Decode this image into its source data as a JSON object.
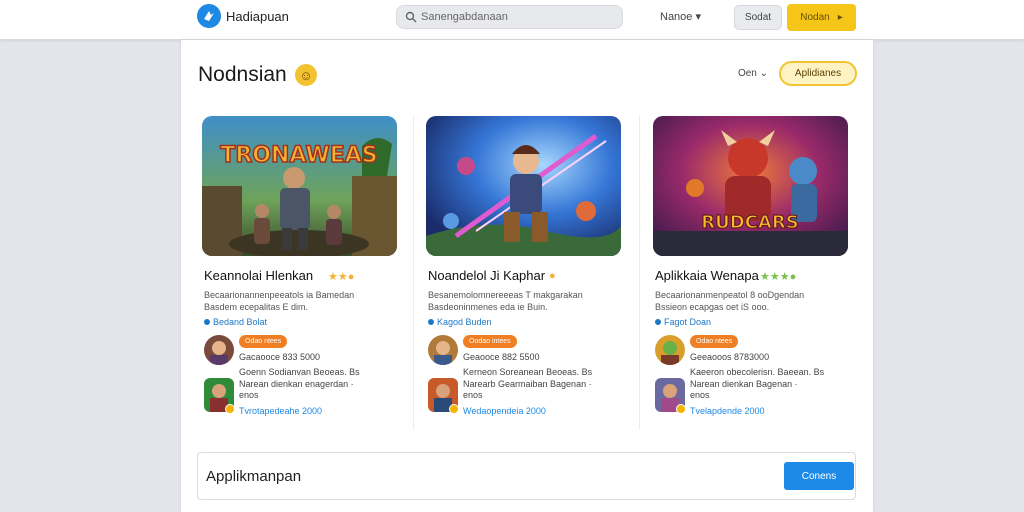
{
  "header": {
    "app_name": "Hadiapuan",
    "search_placeholder": "Sanengabdanaan",
    "nav_menu": "Nanoe",
    "nav_menu_caret": "▾",
    "secondary_button": "Sodat",
    "primary_button": "Nodan"
  },
  "section": {
    "title": "Nodnsian",
    "title_emoji": "☺",
    "filter_label": "Oen",
    "filter_caret": "⌄",
    "filter_button": "Aplidianes"
  },
  "cards": [
    {
      "banner_text": "TRONAWEAS",
      "title": "Keannolai Hlenkan",
      "stars": "★★●",
      "description": "Becaarionannenpeeatols ia Bamedan\nBasdem ecepalitas E dim.",
      "tag": "Bedand Bolat",
      "badge": "Odao ntees",
      "meta": "Gacaooce 833 5000",
      "review": "Goenn Sodianvan Beoeas. Bs\nNarean dienkan enagerdan  ·\nenos",
      "date": "Tvrotapedeahe 2000"
    },
    {
      "banner_text": "",
      "title": "Noandelol Ji Kaphar",
      "stars": "●",
      "description": "Besanemolomnereeeas T makgarakan\nBasdeoninmenes eda ie Buin.",
      "tag": "Kagod Buden",
      "badge": "Oodao intees",
      "meta": "Geaooce 882 5500",
      "review": "Kerneon Soreanean Beoeas. Bs\nNarearb Gearmaiban Bagenan  ·\nenos",
      "date": "Wedaopendeia 2000"
    },
    {
      "banner_text": "RUDCARS",
      "title": "Aplikkaia Wenapa",
      "stars": "★★★●",
      "description": "Becaarionanmenpeatol 8 ooDgendan\nBssieon ecapgas oet iS ooo.",
      "tag": "Fagot Doan",
      "badge": "Odao ntees",
      "meta": "Geeaooos 8783000",
      "review": "Kaeeron obecolerisn. Baeean. Bs\nNarean dienkan Bagenan  ·\nenos",
      "date": "Tvelapdende 2000"
    }
  ],
  "footer": {
    "label": "Applikmanpan",
    "button": "Conens"
  }
}
